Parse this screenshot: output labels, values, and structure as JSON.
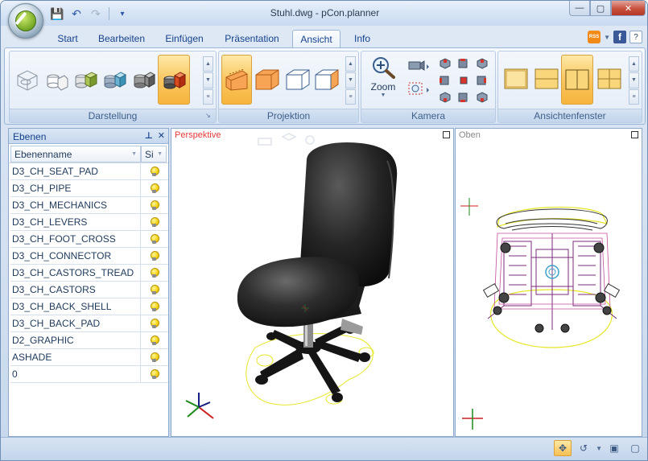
{
  "window": {
    "title": "Stuhl.dwg - pCon.planner",
    "controls": {
      "minimize": "—",
      "maximize": "▢",
      "close": "✕"
    }
  },
  "quick_access": {
    "save": "💾",
    "undo": "↶",
    "redo": "↷",
    "customize": "▾"
  },
  "ribbon": {
    "tabs": [
      "Start",
      "Bearbeiten",
      "Einfügen",
      "Präsentation",
      "Ansicht",
      "Info"
    ],
    "active_tab": "Ansicht",
    "right_icons": {
      "rss": "RSS",
      "facebook": "f",
      "help": "?"
    },
    "groups": {
      "darstellung": "Darstellung",
      "projektion": "Projektion",
      "kamera": "Kamera",
      "zoom_label": "Zoom",
      "ansichtenfenster": "Ansichtenfenster"
    }
  },
  "layers_panel": {
    "title": "Ebenen",
    "col_name": "Ebenenname",
    "col_visible": "Si",
    "layers": [
      "D3_CH_SEAT_PAD",
      "D3_CH_PIPE",
      "D3_CH_MECHANICS",
      "D3_CH_LEVERS",
      "D3_CH_FOOT_CROSS",
      "D3_CH_CONNECTOR",
      "D3_CH_CASTORS_TREAD",
      "D3_CH_CASTORS",
      "D3_CH_BACK_SHELL",
      "D3_CH_BACK_PAD",
      "D2_GRAPHIC",
      "ASHADE",
      "0"
    ]
  },
  "viewports": {
    "perspective_label": "Perspektive",
    "top_label": "Oben"
  },
  "colors": {
    "accent_orange": "#f7bf52",
    "perspective_label": "#e8393a",
    "top_label": "#8a8a8a",
    "footprint": "#e6e627"
  }
}
